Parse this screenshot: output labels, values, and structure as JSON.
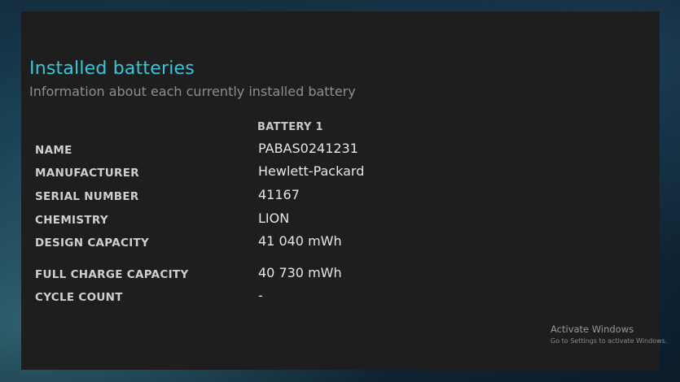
{
  "section": {
    "title": "Installed batteries",
    "subtitle": "Information about each currently installed battery",
    "column_header": "BATTERY 1"
  },
  "rows": [
    {
      "label": "NAME",
      "value": "PABAS0241231"
    },
    {
      "label": "MANUFACTURER",
      "value": "Hewlett-Packard"
    },
    {
      "label": "SERIAL NUMBER",
      "value": "41167"
    },
    {
      "label": "CHEMISTRY",
      "value": "LION"
    },
    {
      "label": "DESIGN CAPACITY",
      "value": "41 040 mWh"
    },
    {
      "label": "FULL CHARGE CAPACITY",
      "value": "40 730 mWh"
    },
    {
      "label": "CYCLE COUNT",
      "value": "-"
    }
  ],
  "watermark": {
    "title": "Activate Windows",
    "subtitle": "Go to Settings to activate Windows."
  },
  "colors": {
    "accent": "#35c8d8",
    "panel_background": "#1e1e1e",
    "subtitle_text": "#8e8e8e"
  }
}
